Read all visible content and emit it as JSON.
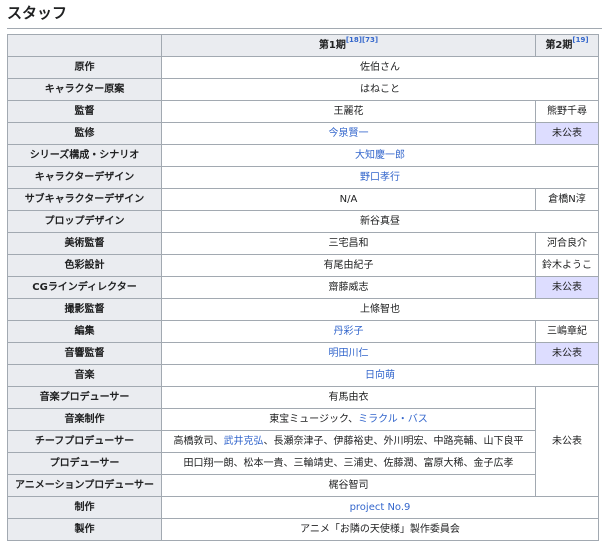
{
  "heading": "スタッフ",
  "header": {
    "col_role": "",
    "col_s1": "第1期",
    "col_s1_refs": "[18][73]",
    "col_s2": "第2期",
    "col_s2_refs": "[19]"
  },
  "rows": [
    {
      "role": "原作",
      "s1": "佐伯さん"
    },
    {
      "role": "キャラクター原案",
      "s1": "はねこと"
    },
    {
      "role": "監督",
      "s1": "王麗花",
      "s2": "熊野千尋"
    },
    {
      "role": "監修",
      "s1": "今泉賢一",
      "s2": "未公表"
    },
    {
      "role": "シリーズ構成・シナリオ",
      "s1": "大知慶一郎"
    },
    {
      "role": "キャラクターデザイン",
      "s1": "野口孝行"
    },
    {
      "role": "サブキャラクターデザイン",
      "s1": "N/A",
      "s2": "倉橋N淳"
    },
    {
      "role": "プロップデザイン",
      "s1": "新谷真昼"
    },
    {
      "role": "美術監督",
      "s1": "三宅昌和",
      "s2": "河合良介"
    },
    {
      "role": "色彩設計",
      "s1": "有尾由紀子",
      "s2": "鈴木ようこ"
    },
    {
      "role": "CGラインディレクター",
      "s1": "齋藤威志",
      "s2": "未公表"
    },
    {
      "role": "撮影監督",
      "s1": "上條智也"
    },
    {
      "role": "編集",
      "s1": "丹彩子",
      "s2": "三嶋章紀"
    },
    {
      "role": "音響監督",
      "s1": "明田川仁",
      "s2": "未公表"
    },
    {
      "role": "音楽",
      "s1": "日向萌"
    },
    {
      "role": "音楽プロデューサー",
      "s1": "有馬由衣",
      "s2_merged": "未公表"
    },
    {
      "role": "音楽制作",
      "s1_a": "東宝ミュージック、",
      "s1_b": "ミラクル・バス"
    },
    {
      "role": "チーフプロデューサー",
      "s1_a": "高橋敦司、",
      "s1_b": "武井克弘",
      "s1_c": "、長瀬奈津子、伊藤裕史、外川明宏、中路亮輔、山下良平"
    },
    {
      "role": "プロデューサー",
      "s1": "田口翔一朗、松本一貴、三輪靖史、三浦史、佐藤潤、富原大稀、金子広孝"
    },
    {
      "role": "アニメーションプロデューサー",
      "s1": "梶谷智司"
    },
    {
      "role": "制作",
      "s1": "project No.9"
    },
    {
      "role": "製作",
      "s1": "アニメ「お隣の天使様」製作委員会"
    }
  ],
  "colors": {
    "link": "#3366cc",
    "tbd_bg": "#ddddff",
    "header_bg": "#eaecf0",
    "border": "#a2a9b1"
  }
}
